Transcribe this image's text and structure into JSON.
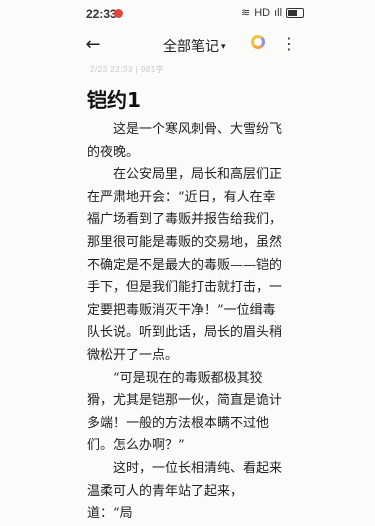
{
  "status_bar": {
    "time": "22:33",
    "notification_icon": "app-notification-icon",
    "icons": [
      "wifi-icon",
      "signal-icon",
      "signal-icon",
      "battery-icon"
    ],
    "wifi_text": "≋",
    "hd_text": "HD",
    "signal_text": "ıll"
  },
  "toolbar": {
    "back_icon": "back-arrow-icon",
    "back_glyph": "←",
    "folder_title": "全部笔记",
    "caret": "▾",
    "theme_icon": "color-theme-icon",
    "more_icon": "more-vertical-icon",
    "more_glyph": "⋮"
  },
  "note": {
    "meta": "2/23 22:33  |  981字",
    "title": "铠约1",
    "paragraphs": [
      "这是一个寒风刺骨、大雪纷飞的夜晚。",
      "在公安局里，局长和高层们正在严肃地开会：“近日，有人在幸福广场看到了毒贩并报告给我们，那里很可能是毒贩的交易地，虽然不确定是不是最大的毒贩——铠的手下，但是我们能打击就打击，一定要把毒贩消灭干净！”一位缉毒队长说。听到此话，局长的眉头稍微松开了一点。",
      "“可是现在的毒贩都极其狡猾，尤其是铠那一伙，简直是诡计多端！一般的方法根本瞒不过他们。怎么办啊？”",
      "这时，一位长相清纯、看起来温柔可人的青年站了起来，道：“局"
    ]
  }
}
